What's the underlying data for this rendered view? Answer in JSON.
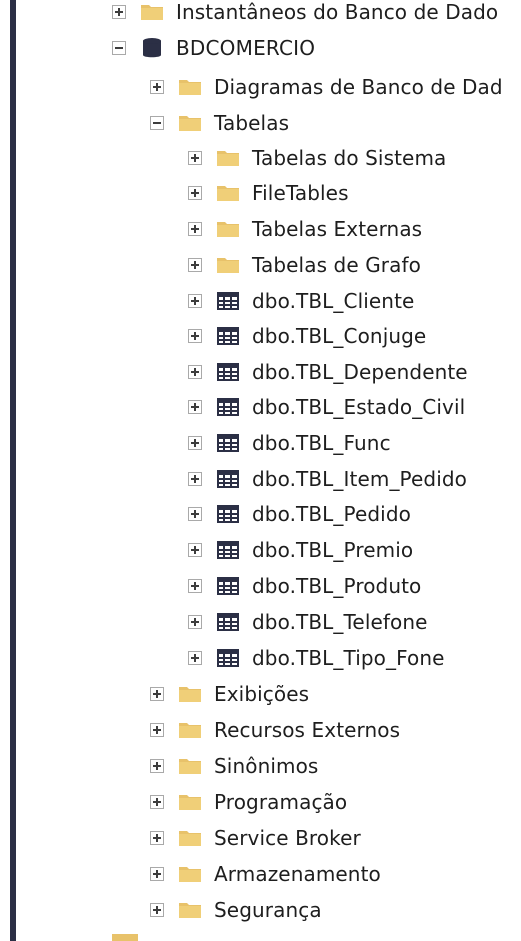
{
  "tree": {
    "instantaneos": "Instantâneos do Banco de Dado",
    "database": "BDCOMERCIO",
    "diagramas": "Diagramas de Banco de Dad",
    "tabelas": "Tabelas",
    "tabelas_children": [
      "Tabelas do Sistema",
      "FileTables",
      "Tabelas Externas",
      "Tabelas de Grafo",
      "dbo.TBL_Cliente",
      "dbo.TBL_Conjuge",
      "dbo.TBL_Dependente",
      "dbo.TBL_Estado_Civil",
      "dbo.TBL_Func",
      "dbo.TBL_Item_Pedido",
      "dbo.TBL_Pedido",
      "dbo.TBL_Premio",
      "dbo.TBL_Produto",
      "dbo.TBL_Telefone",
      "dbo.TBL_Tipo_Fone"
    ],
    "siblings": [
      "Exibições",
      "Recursos Externos",
      "Sinônimos",
      "Programação",
      "Service Broker",
      "Armazenamento",
      "Segurança"
    ]
  },
  "colors": {
    "folder": "#e8c26a",
    "table_icon": "#2b2f45",
    "left_bar": "#2b2f45"
  }
}
